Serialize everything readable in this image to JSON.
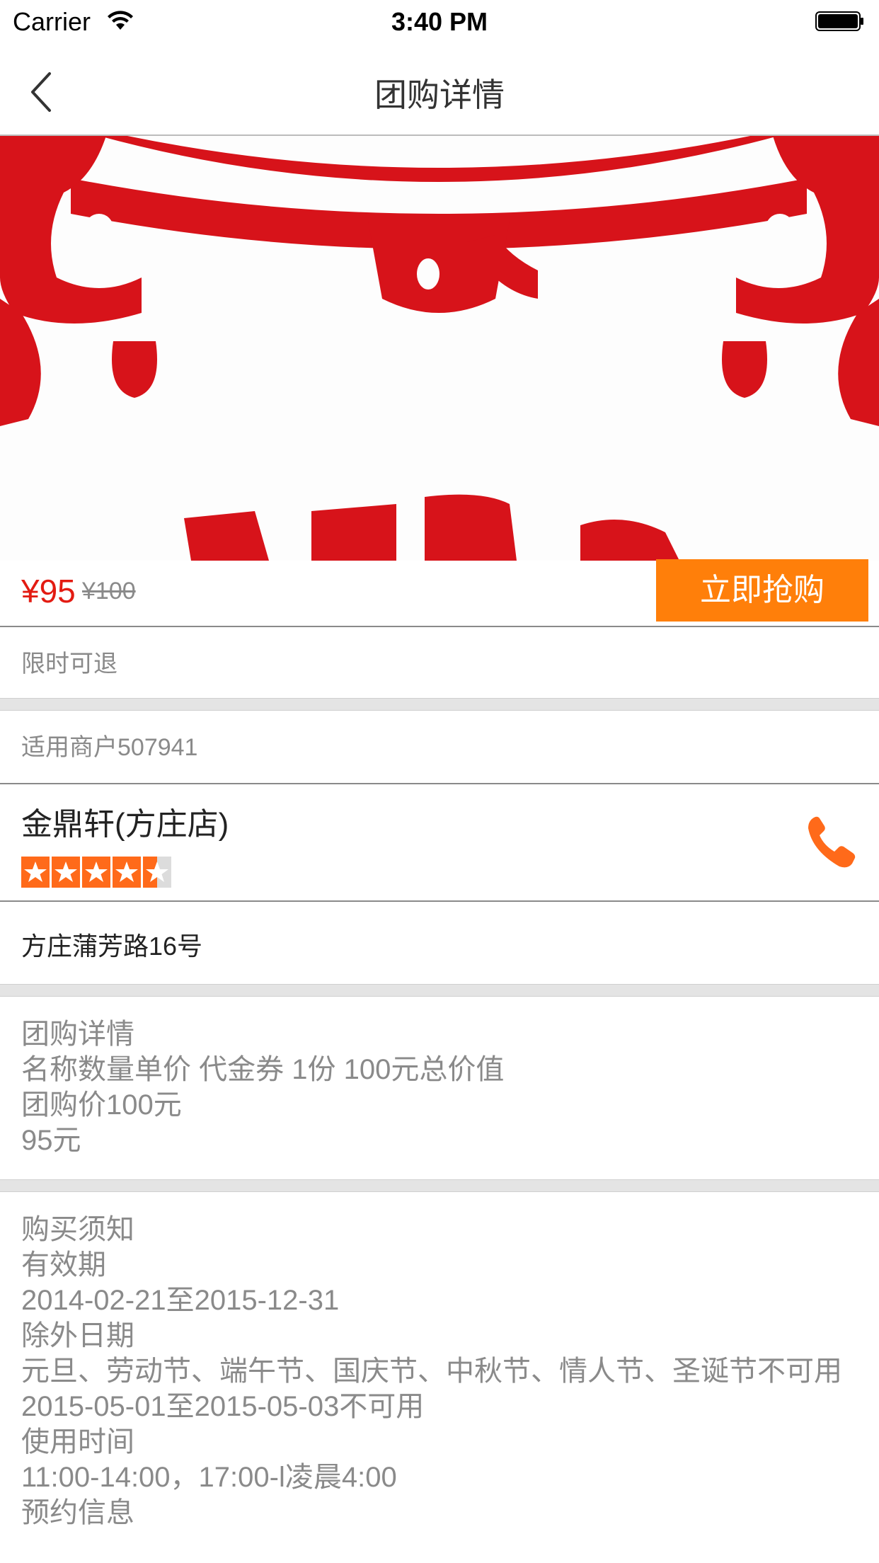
{
  "status_bar": {
    "carrier": "Carrier",
    "time": "3:40 PM"
  },
  "nav": {
    "title": "团购详情"
  },
  "price": {
    "current": "¥95",
    "original": "¥100",
    "buy_label": "立即抢购"
  },
  "refund_text": "限时可退",
  "merchant": {
    "header": "适用商户507941",
    "name": "金鼎轩(方庄店)",
    "rating_stars": 4.5,
    "address": "方庄蒲芳路16号"
  },
  "colors": {
    "accent": "#ff7f0a",
    "price_red": "#e31b12",
    "hero_red": "#d7131a"
  },
  "icons": {
    "back": "chevron-left-icon",
    "phone": "phone-icon",
    "star": "star-icon"
  },
  "detail": {
    "title": "团购详情",
    "lines": [
      "名称数量单价 代金券 1份 100元总价值",
      "团购价100元",
      "95元"
    ]
  },
  "notice": {
    "title": "购买须知",
    "lines": [
      "有效期",
      "2014-02-21至2015-12-31",
      "除外日期",
      "元旦、劳动节、端午节、国庆节、中秋节、情人节、圣诞节不可用",
      "2015-05-01至2015-05-03不可用",
      "使用时间",
      "11:00-14:00，17:00-l凌晨4:00",
      "预约信息"
    ]
  }
}
